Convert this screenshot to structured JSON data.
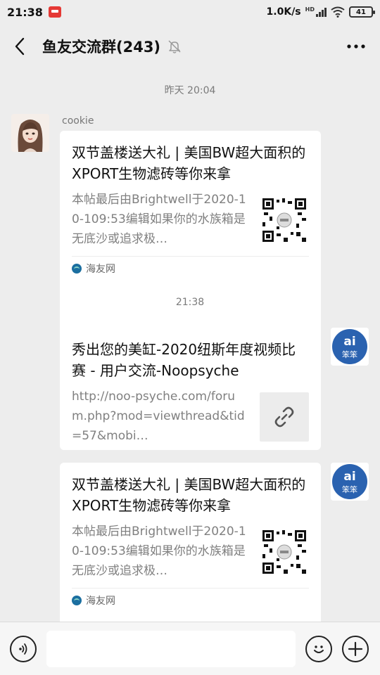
{
  "status_bar": {
    "time": "21:38",
    "network_speed": "1.0K/s",
    "hd_label": "HD",
    "battery_level": "41"
  },
  "header": {
    "title": "鱼友交流群(243)"
  },
  "messages": [
    {
      "type": "timestamp",
      "text": "昨天 20:04"
    },
    {
      "type": "card",
      "side": "left",
      "sender": "cookie",
      "title": "双节盖楼送大礼 | 美国BW超大面积的XPORT生物滤砖等你来拿",
      "description": "本帖最后由Brightwell于2020-10-109:53编辑如果你的水族箱是无底沙或追求极…",
      "thumbnail": "qr-code",
      "source": "海友网"
    },
    {
      "type": "timestamp",
      "text": "21:38"
    },
    {
      "type": "card",
      "side": "right",
      "title": "秀出您的美缸-2020纽斯年度视频比赛 - 用户交流-Noopsyche",
      "description": "http://noo-psyche.com/forum.php?mod=viewthread&tid=57&mobi…",
      "thumbnail": "link-icon"
    },
    {
      "type": "card",
      "side": "right",
      "title": "双节盖楼送大礼 | 美国BW超大面积的XPORT生物滤砖等你来拿",
      "description": "本帖最后由Brightwell于2020-10-109:53编辑如果你的水族箱是无底沙或追求极…",
      "thumbnail": "qr-code",
      "source": "海友网"
    }
  ],
  "self_avatar_text": "ai 笨笨",
  "input": {
    "value": "",
    "placeholder": ""
  },
  "colors": {
    "background": "#ededed",
    "card": "#ffffff",
    "timestamp": "#7a7a7a",
    "description": "#808080",
    "avatar_blue": "#2a62b0"
  }
}
